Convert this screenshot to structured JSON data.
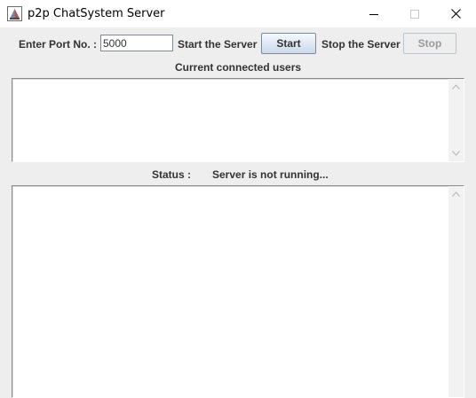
{
  "window": {
    "title": "p2p ChatSystem Server",
    "controls": {
      "minimize_icon": "minimize-icon",
      "maximize_icon": "maximize-icon",
      "close_icon": "close-icon"
    }
  },
  "toolbar": {
    "port_label": "Enter Port No. :",
    "port_value": "5000",
    "start_label": "Start the Server",
    "start_button": "Start",
    "stop_label": "Stop the Server",
    "stop_button": "Stop"
  },
  "users": {
    "heading": "Current connected users",
    "items": []
  },
  "status": {
    "label": "Status :",
    "value": "Server is not running...",
    "log": ""
  },
  "colors": {
    "background": "#eeeeee",
    "text": "#333333",
    "start_button_top": "#f5f9fd",
    "start_button_bottom": "#c9d9ea",
    "disabled_text": "#9a9a9a"
  }
}
